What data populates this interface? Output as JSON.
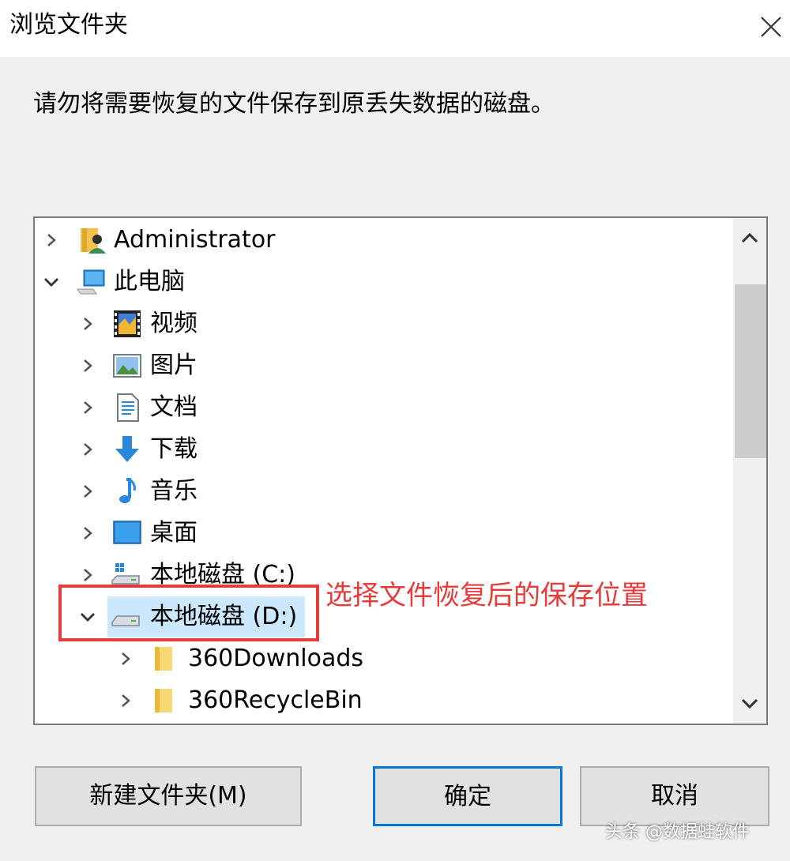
{
  "window": {
    "title": "浏览文件夹"
  },
  "instruction": "请勿将需要恢复的文件保存到原丢失数据的磁盘。",
  "tree": {
    "items": [
      {
        "label": "Administrator",
        "icon": "user-folder-icon",
        "expanded": false,
        "level": 0
      },
      {
        "label": "此电脑",
        "icon": "computer-icon",
        "expanded": true,
        "level": 0
      },
      {
        "label": "视频",
        "icon": "video-icon",
        "expanded": false,
        "level": 1
      },
      {
        "label": "图片",
        "icon": "pictures-icon",
        "expanded": false,
        "level": 1
      },
      {
        "label": "文档",
        "icon": "documents-icon",
        "expanded": false,
        "level": 1
      },
      {
        "label": "下载",
        "icon": "download-icon",
        "expanded": false,
        "level": 1
      },
      {
        "label": "音乐",
        "icon": "music-icon",
        "expanded": false,
        "level": 1
      },
      {
        "label": "桌面",
        "icon": "desktop-icon",
        "expanded": false,
        "level": 1
      },
      {
        "label": "本地磁盘 (C:)",
        "icon": "system-drive-icon",
        "expanded": false,
        "level": 1
      },
      {
        "label": "本地磁盘 (D:)",
        "icon": "drive-icon",
        "expanded": true,
        "level": 1,
        "selected": true
      },
      {
        "label": "360Downloads",
        "icon": "folder-icon",
        "expanded": false,
        "level": 2
      },
      {
        "label": "360RecycleBin",
        "icon": "folder-icon",
        "expanded": false,
        "level": 2
      }
    ]
  },
  "annotation": "选择文件恢复后的保存位置",
  "buttons": {
    "new_folder": "新建文件夹(M)",
    "ok": "确定",
    "cancel": "取消"
  },
  "watermark": "头条 @数据蛙软件",
  "colors": {
    "annotation_red": "#e53b3b",
    "selection_blue": "#cce8ff",
    "primary_border": "#0078d7"
  }
}
